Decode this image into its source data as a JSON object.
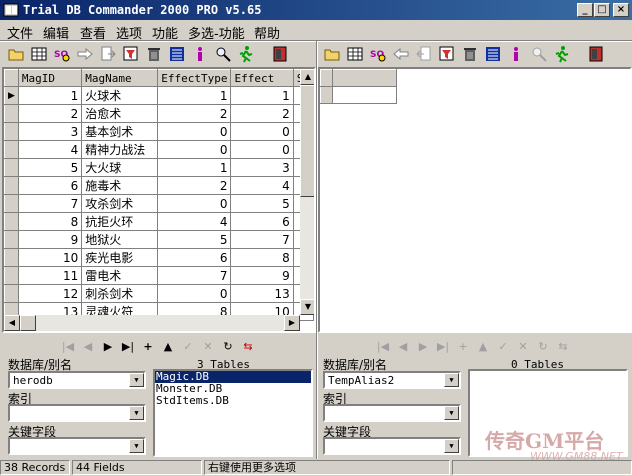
{
  "window": {
    "title": "Trial DB Commander 2000 PRO v5.65"
  },
  "menu": [
    "文件",
    "编辑",
    "查看",
    "选项",
    "功能",
    "多选-功能",
    "帮助"
  ],
  "left_grid": {
    "columns": [
      "MagID",
      "MagName",
      "EffectType",
      "Effect",
      "Sp"
    ],
    "rows": [
      [
        "1",
        "火球术",
        "1",
        "1"
      ],
      [
        "2",
        "治愈术",
        "2",
        "2"
      ],
      [
        "3",
        "基本剑术",
        "0",
        "0"
      ],
      [
        "4",
        "精神力战法",
        "0",
        "0"
      ],
      [
        "5",
        "大火球",
        "1",
        "3"
      ],
      [
        "6",
        "施毒术",
        "2",
        "4"
      ],
      [
        "7",
        "攻杀剑术",
        "0",
        "5"
      ],
      [
        "8",
        "抗拒火环",
        "4",
        "6"
      ],
      [
        "9",
        "地狱火",
        "5",
        "7"
      ],
      [
        "10",
        "疾光电影",
        "6",
        "8"
      ],
      [
        "11",
        "雷电术",
        "7",
        "9"
      ],
      [
        "12",
        "刺杀剑术",
        "0",
        "13"
      ],
      [
        "13",
        "灵魂火符",
        "8",
        "10"
      ]
    ]
  },
  "left_panel": {
    "db_label": "数据库/别名",
    "db_value": "herodb",
    "index_label": "索引",
    "index_value": "",
    "key_label": "关键字段",
    "key_value": "",
    "tables_count": "3 Tables",
    "tables": [
      "Magic.DB",
      "Monster.DB",
      "StdItems.DB"
    ],
    "selected_table": "Magic.DB"
  },
  "right_panel": {
    "db_label": "数据库/别名",
    "db_value": "TempAlias2",
    "index_label": "索引",
    "index_value": "",
    "key_label": "关键字段",
    "key_value": "",
    "tables_count": "0 Tables",
    "tables": []
  },
  "status": {
    "records": "38 Records",
    "fields": "44 Fields",
    "hint": "右键使用更多选项"
  },
  "watermark": {
    "text": "传奇GM平台",
    "url": "WWW.GM88.NET"
  }
}
